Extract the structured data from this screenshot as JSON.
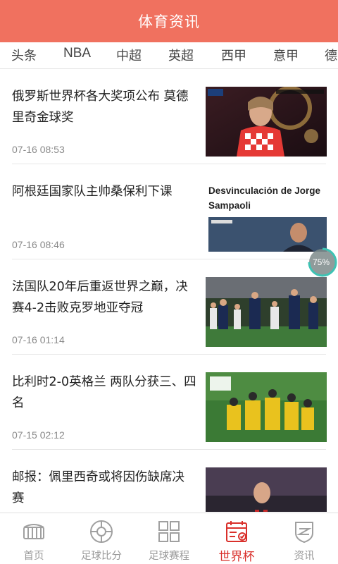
{
  "header": {
    "title": "体育资讯"
  },
  "tabs": [
    {
      "label": "头条"
    },
    {
      "label": "NBA"
    },
    {
      "label": "中超"
    },
    {
      "label": "英超"
    },
    {
      "label": "西甲"
    },
    {
      "label": "意甲"
    },
    {
      "label": "德"
    }
  ],
  "news": [
    {
      "title": "俄罗斯世界杯各大奖项公布 莫德里奇金球奖",
      "time": "07-16 08:53",
      "thumb_icon": "modric-photo"
    },
    {
      "title": "阿根廷国家队主帅桑保利下课",
      "time": "07-16 08:46",
      "thumb_icon": "sampaoli-photo",
      "thumb_text": "Desvinculación de Jorge Sampaoli"
    },
    {
      "title": "法国队20年后重返世界之巅，决赛4-2击败克罗地亚夺冠",
      "time": "07-16 01:14",
      "thumb_icon": "france-celebration-photo"
    },
    {
      "title": "比利时2-0英格兰 两队分获三、四名",
      "time": "07-15 02:12",
      "thumb_icon": "belgium-celebration-photo"
    },
    {
      "title": "邮报：佩里西奇或将因伤缺席决赛",
      "time": "",
      "thumb_icon": "perisic-photo"
    }
  ],
  "progress_badge": {
    "value": 0.75,
    "label": "75%"
  },
  "bottom_nav": [
    {
      "label": "首页",
      "icon": "stadium-icon",
      "active": false
    },
    {
      "label": "足球比分",
      "icon": "football-icon",
      "active": false
    },
    {
      "label": "足球赛程",
      "icon": "grid-icon",
      "active": false
    },
    {
      "label": "世界杯",
      "icon": "calendar-check-icon",
      "active": true
    },
    {
      "label": "资讯",
      "icon": "shield-news-icon",
      "active": false
    }
  ],
  "colors": {
    "header_bg": "#f0715f",
    "active_nav": "#d9302b",
    "inactive_nav": "#999999",
    "badge_ring": "#3ec3b4"
  }
}
